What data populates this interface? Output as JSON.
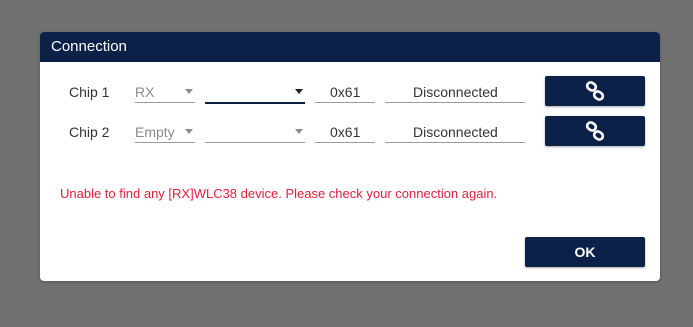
{
  "dialog": {
    "title": "Connection",
    "chips": [
      {
        "label": "Chip 1",
        "mode": "RX",
        "device": "",
        "address": "0x61",
        "status": "Disconnected",
        "connect_icon": "link-icon"
      },
      {
        "label": "Chip 2",
        "mode": "Empty",
        "device": "",
        "address": "0x61",
        "status": "Disconnected",
        "connect_icon": "link-icon"
      }
    ],
    "error_message": "Unable to find any [RX]WLC38 device. Please check your connection again.",
    "ok_label": "OK"
  },
  "colors": {
    "backdrop": "#707070",
    "title_bar": "#0b2148",
    "button": "#0b2148",
    "error_text": "#e0203c"
  }
}
